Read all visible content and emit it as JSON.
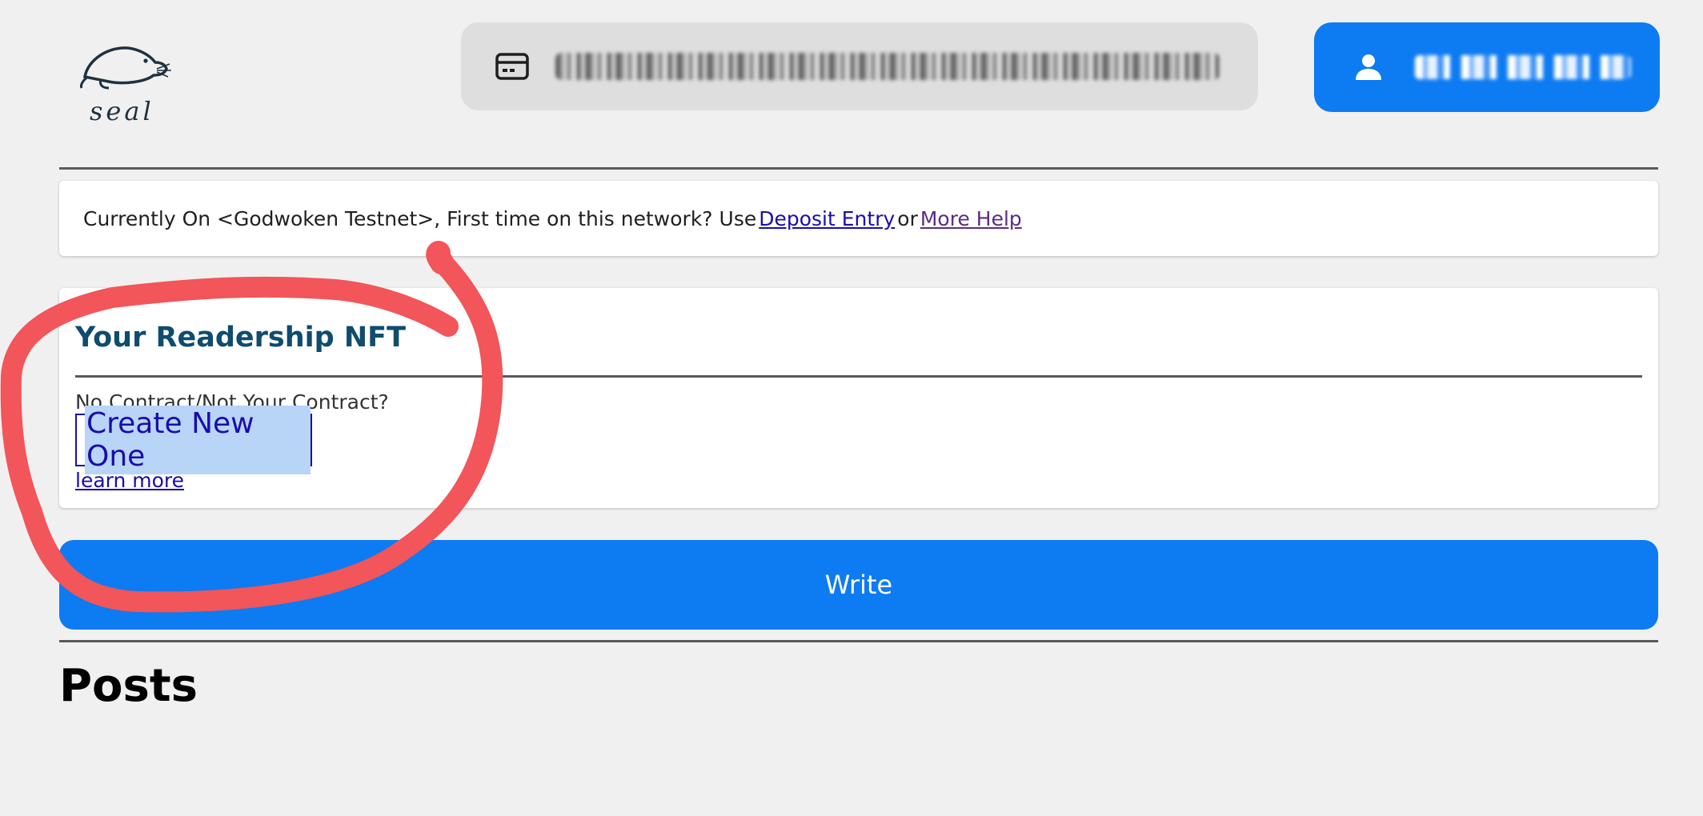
{
  "header": {
    "logo_text": "seal",
    "wallet": {
      "icon": "card-icon",
      "address_text": ""
    },
    "account": {
      "icon": "user-icon",
      "label": ""
    }
  },
  "notice": {
    "prefix": "Currently On <Godwoken Testnet>, First time on this network? Use",
    "deposit_link": "Deposit Entry",
    "or": "or",
    "help_link": "More Help"
  },
  "nft": {
    "title": "Your Readership NFT",
    "question": "No Contract/Not Your Contract?",
    "create_button": "Create New One",
    "learn_more": "learn more"
  },
  "write_button": "Write",
  "posts_title": "Posts",
  "colors": {
    "accent_blue": "#0d7bf2",
    "link": "#1a0dab",
    "visited_link": "#5a2d82",
    "title_teal": "#0f4c6e",
    "annotation_red": "#f2555a",
    "background": "#f0f0f0"
  }
}
